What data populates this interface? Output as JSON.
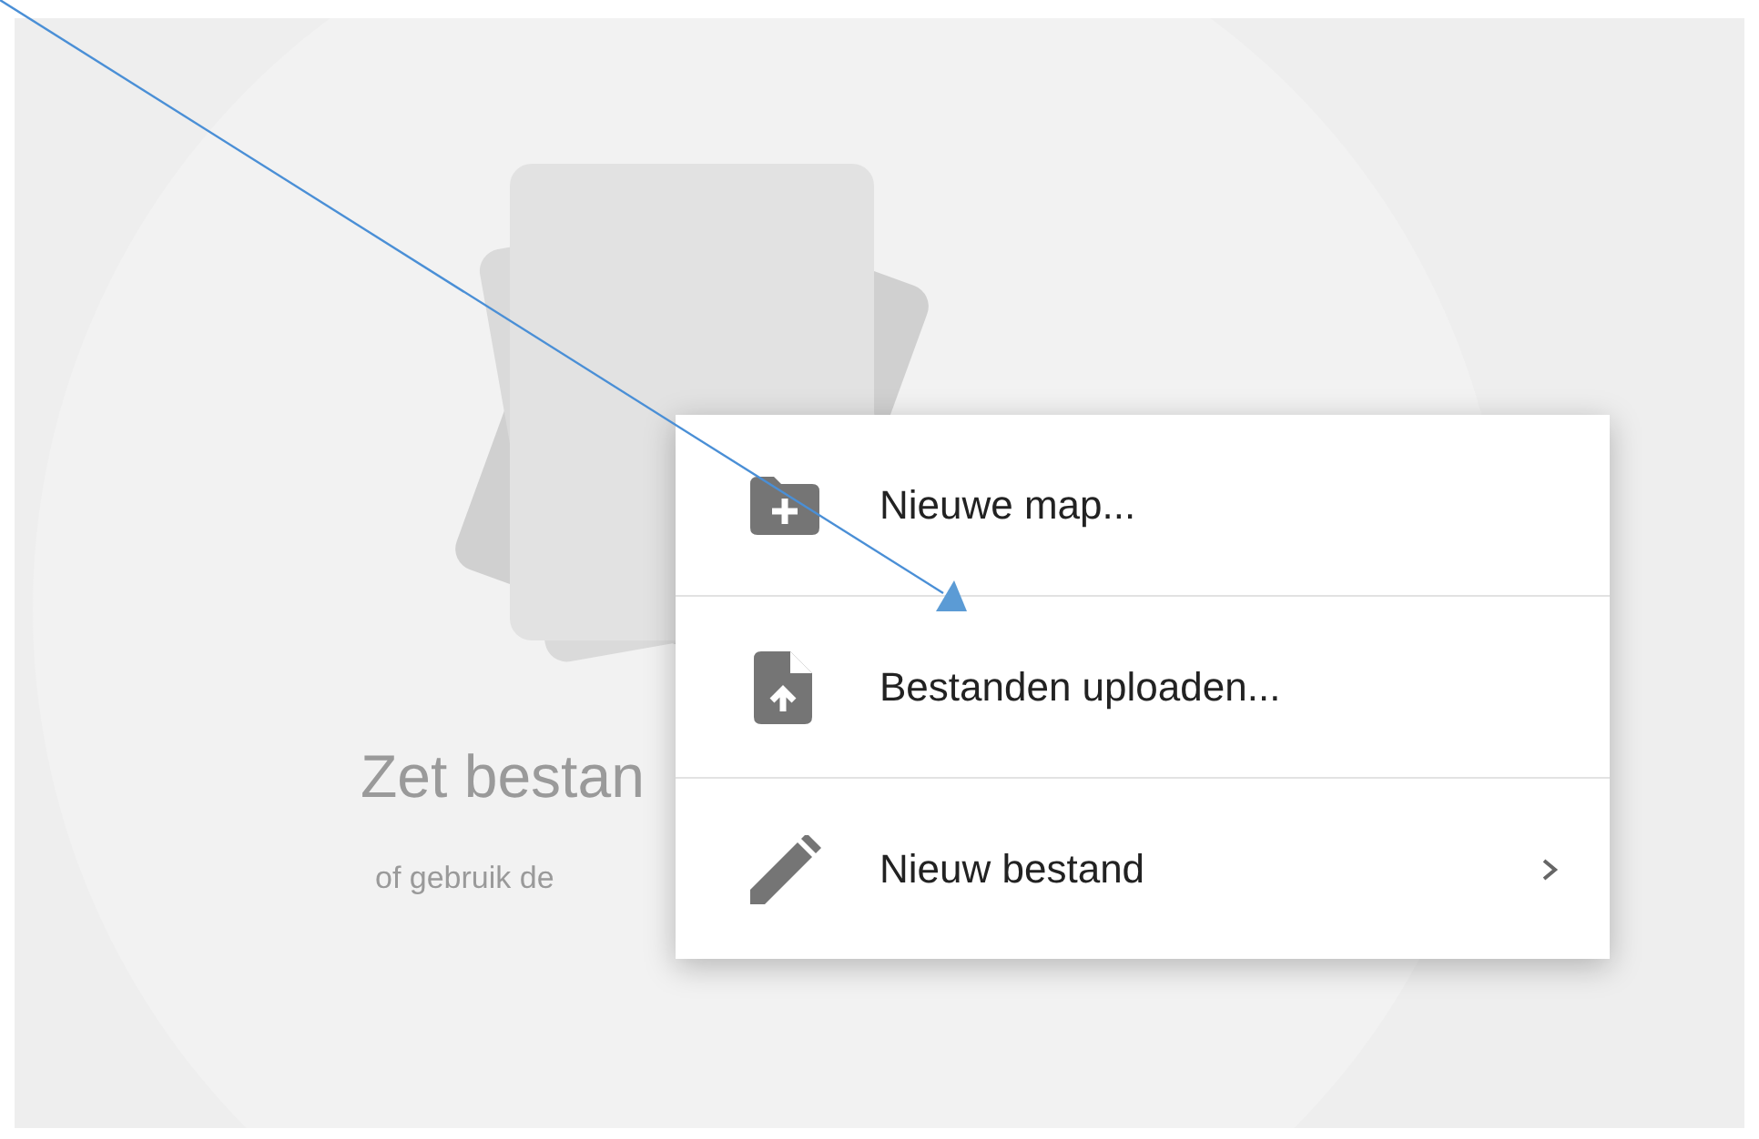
{
  "drop_zone": {
    "title": "Zet bestan",
    "subtitle": "of gebruik de"
  },
  "context_menu": {
    "items": [
      {
        "kind": "folder-add",
        "label": "Nieuwe map...",
        "has_submenu": false
      },
      {
        "kind": "file-upload",
        "label": "Bestanden uploaden...",
        "has_submenu": false
      },
      {
        "kind": "pencil",
        "label": "Nieuw bestand",
        "has_submenu": true
      }
    ]
  }
}
